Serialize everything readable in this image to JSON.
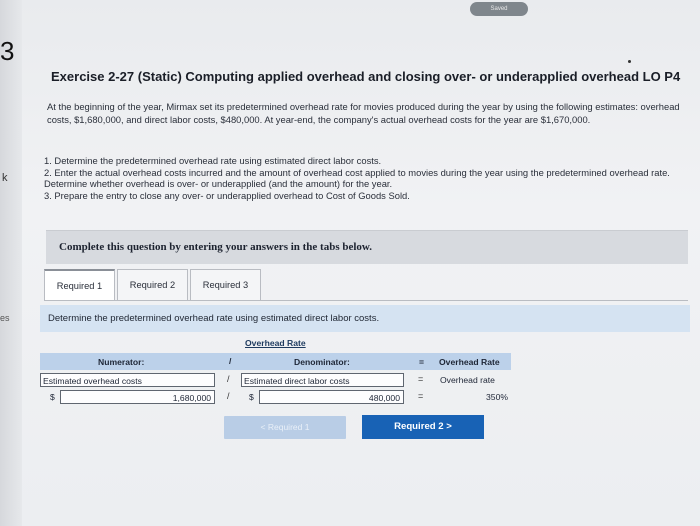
{
  "edge": {
    "chapter_number": "3",
    "left_letter": "k",
    "left_fragment": "es"
  },
  "status": {
    "saved": "Saved"
  },
  "exercise": {
    "title": "Exercise 2-27 (Static) Computing applied overhead and closing over- or underapplied overhead LO P4",
    "intro": "At the beginning of the year, Mirmax set its predetermined overhead rate for movies produced during the year by using the following estimates: overhead costs, $1,680,000, and direct labor costs, $480,000. At year-end, the company's actual overhead costs for the year are $1,670,000.",
    "requirements": [
      "1. Determine the predetermined overhead rate using estimated direct labor costs.",
      "2. Enter the actual overhead costs incurred and the amount of overhead cost applied to movies during the year using the predetermined overhead rate. Determine whether overhead is over- or underapplied (and the amount) for the year.",
      "3. Prepare the entry to close any over- or underapplied overhead to Cost of Goods Sold."
    ]
  },
  "complete_banner": "Complete this question by entering your answers in the tabs below.",
  "tabs": [
    {
      "label": "Required 1",
      "active": true
    },
    {
      "label": "Required 2",
      "active": false
    },
    {
      "label": "Required 3",
      "active": false
    }
  ],
  "instruction": "Determine the predetermined overhead rate using estimated direct labor costs.",
  "overhead_table": {
    "title": "Overhead Rate",
    "numerator_header": "Numerator:",
    "divide_symbol": "/",
    "denominator_header": "Denominator:",
    "equals_symbol": "=",
    "result_header": "Overhead Rate",
    "numerator_label": "Estimated overhead costs",
    "denominator_label": "Estimated direct labor costs",
    "result_label": "Overhead rate",
    "currency_symbol": "$",
    "numerator_value": "1,680,000",
    "denominator_value": "480,000",
    "result_value": "350%"
  },
  "nav": {
    "prev_label": "< Required 1",
    "next_label": "Required 2  >"
  }
}
